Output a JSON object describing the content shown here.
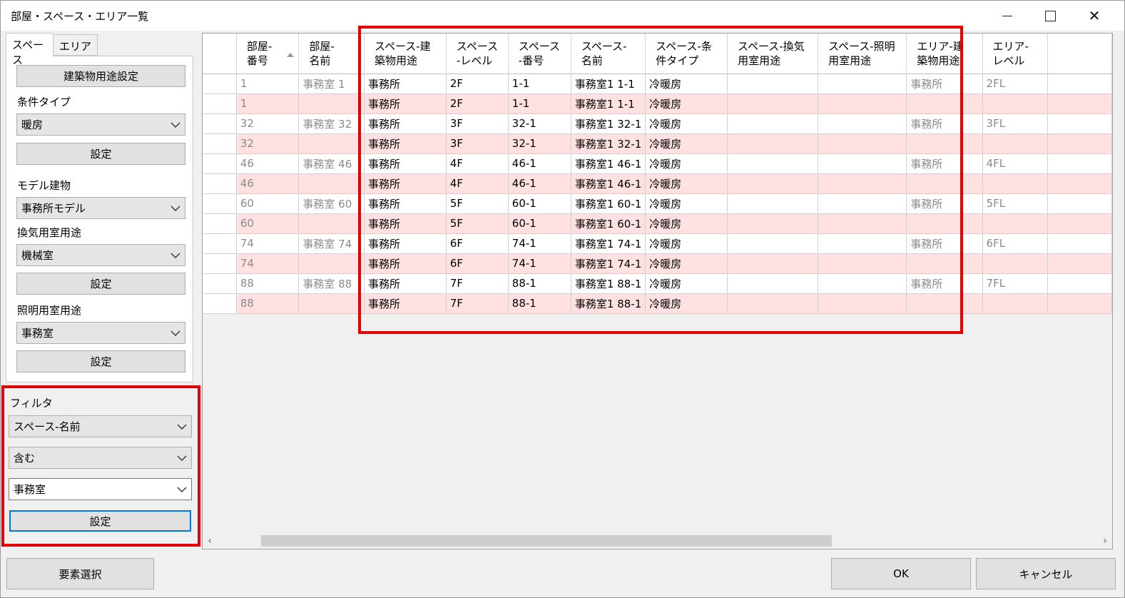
{
  "window": {
    "title": "部屋・スペース・エリア一覧"
  },
  "tabs": [
    {
      "label": "スペース",
      "active": true
    },
    {
      "label": "エリア",
      "active": false
    }
  ],
  "space_panel": {
    "building_use_button": "建築物用途設定",
    "condition_type_label": "条件タイプ",
    "condition_type_value": "暖房",
    "set_button_1": "設定",
    "model_building_label": "モデル建物",
    "model_building_value": "事務所モデル",
    "ventilation_use_label": "換気用室用途",
    "ventilation_use_value": "機械室",
    "set_button_2": "設定",
    "lighting_use_label": "照明用室用途",
    "lighting_use_value": "事務室",
    "set_button_3": "設定"
  },
  "filter": {
    "label": "フィルタ",
    "field_value": "スペース-名前",
    "operator_value": "含む",
    "text_value": "事務室",
    "set_button": "設定"
  },
  "footer": {
    "select_elements_button": "要素選択",
    "ok_button": "OK",
    "cancel_button": "キャンセル"
  },
  "table": {
    "columns": [
      "部屋-\n番号",
      "部屋-\n名前",
      "スペース-建\n築物用途",
      "スペース\n-レベル",
      "スペース\n-番号",
      "スペース-\n名前",
      "スペース-条\n件タイプ",
      "スペース-換気\n用室用途",
      "スペース-照明\n用室用途",
      "エリア-建\n築物用途",
      "エリア-\nレベル"
    ],
    "rows": [
      [
        "1",
        "事務室 1",
        "事務所",
        "2F",
        "1-1",
        "事務室1 1-1",
        "冷暖房",
        "",
        "",
        "事務所",
        "2FL"
      ],
      [
        "1",
        "",
        "事務所",
        "2F",
        "1-1",
        "事務室1 1-1",
        "冷暖房",
        "",
        "",
        "",
        ""
      ],
      [
        "32",
        "事務室 32",
        "事務所",
        "3F",
        "32-1",
        "事務室1 32-1",
        "冷暖房",
        "",
        "",
        "事務所",
        "3FL"
      ],
      [
        "32",
        "",
        "事務所",
        "3F",
        "32-1",
        "事務室1 32-1",
        "冷暖房",
        "",
        "",
        "",
        ""
      ],
      [
        "46",
        "事務室 46",
        "事務所",
        "4F",
        "46-1",
        "事務室1 46-1",
        "冷暖房",
        "",
        "",
        "事務所",
        "4FL"
      ],
      [
        "46",
        "",
        "事務所",
        "4F",
        "46-1",
        "事務室1 46-1",
        "冷暖房",
        "",
        "",
        "",
        ""
      ],
      [
        "60",
        "事務室 60",
        "事務所",
        "5F",
        "60-1",
        "事務室1 60-1",
        "冷暖房",
        "",
        "",
        "事務所",
        "5FL"
      ],
      [
        "60",
        "",
        "事務所",
        "5F",
        "60-1",
        "事務室1 60-1",
        "冷暖房",
        "",
        "",
        "",
        ""
      ],
      [
        "74",
        "事務室 74",
        "事務所",
        "6F",
        "74-1",
        "事務室1 74-1",
        "冷暖房",
        "",
        "",
        "事務所",
        "6FL"
      ],
      [
        "74",
        "",
        "事務所",
        "6F",
        "74-1",
        "事務室1 74-1",
        "冷暖房",
        "",
        "",
        "",
        ""
      ],
      [
        "88",
        "事務室 88",
        "事務所",
        "7F",
        "88-1",
        "事務室1 88-1",
        "冷暖房",
        "",
        "",
        "事務所",
        "7FL"
      ],
      [
        "88",
        "",
        "事務所",
        "7F",
        "88-1",
        "事務室1 88-1",
        "冷暖房",
        "",
        "",
        "",
        ""
      ]
    ]
  },
  "colors": {
    "highlight_row": "#ffe1e1",
    "annotation_red": "#e30000",
    "focus_blue": "#0078d7"
  }
}
